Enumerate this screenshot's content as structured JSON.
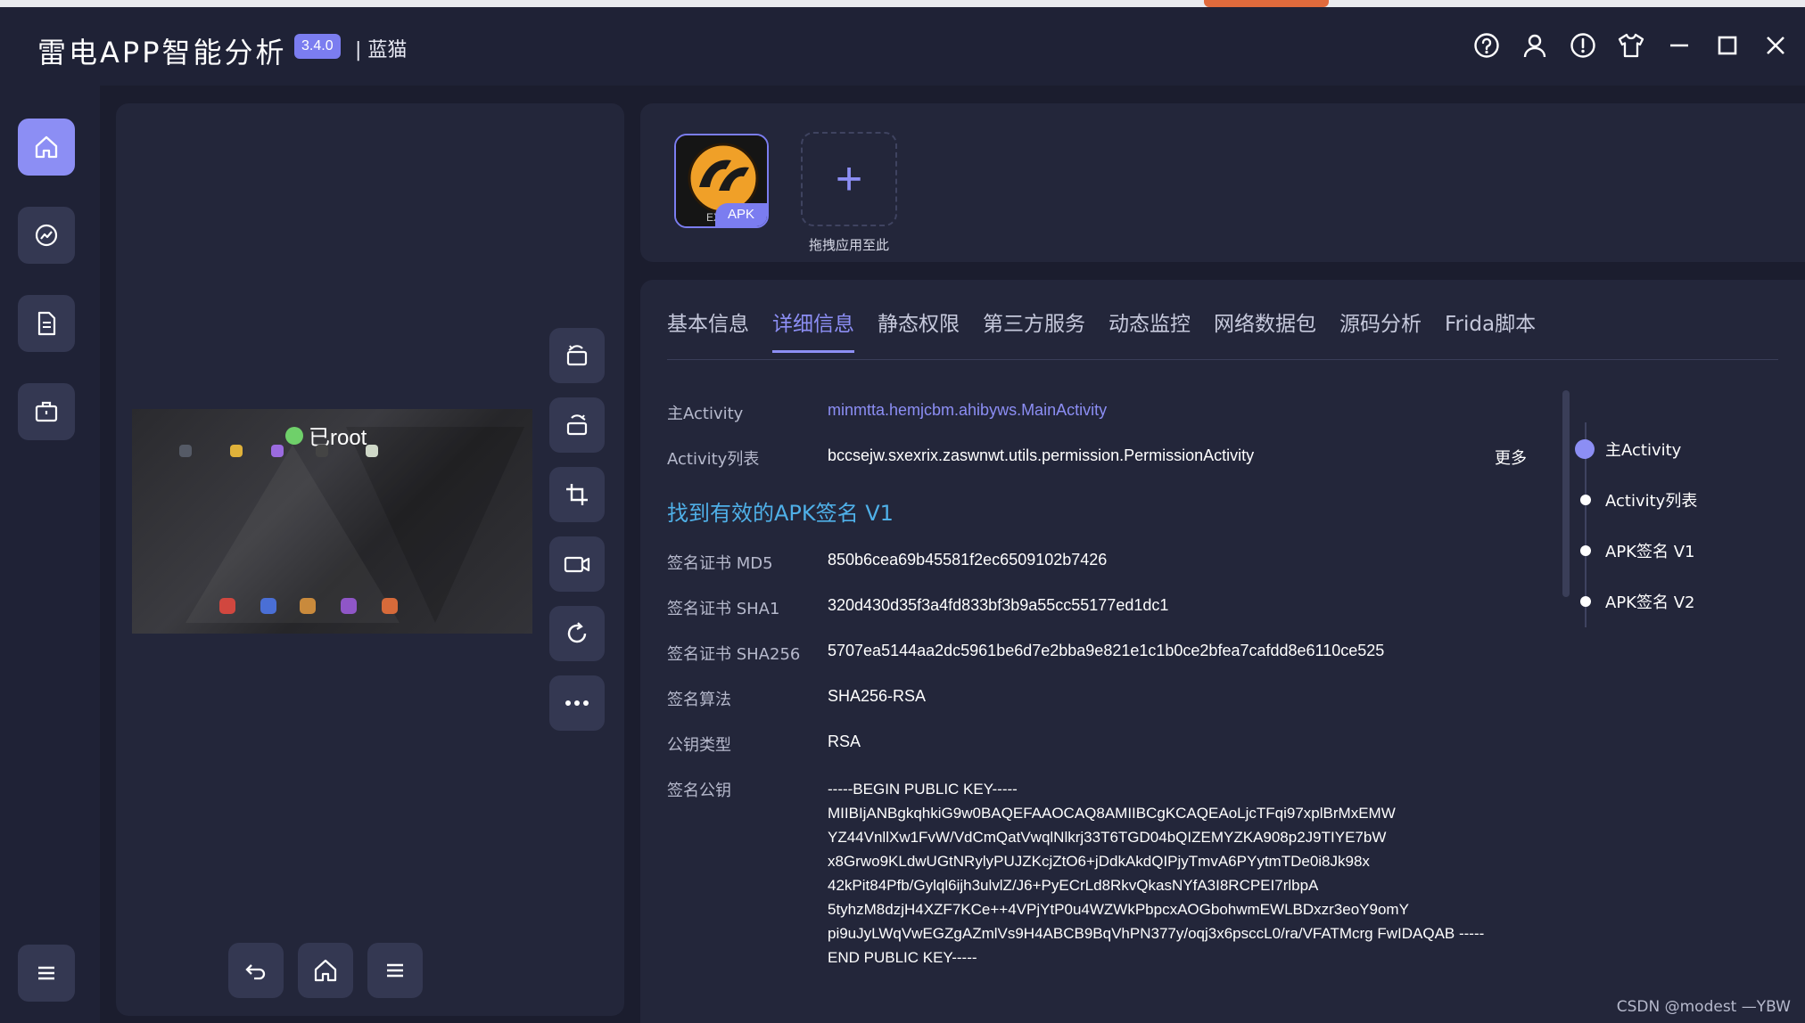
{
  "app": {
    "title": "雷电APP智能分析",
    "version": "3.4.0",
    "edition": "| 蓝猫"
  },
  "window_controls": [
    "help-icon",
    "user-icon",
    "alert-icon",
    "shirt-icon",
    "minimize-icon",
    "maximize-icon",
    "close-icon"
  ],
  "sidebar": {
    "items": [
      {
        "name": "home",
        "icon": "home-icon",
        "active": true
      },
      {
        "name": "analysis",
        "icon": "chart-icon",
        "active": false
      },
      {
        "name": "report",
        "icon": "document-icon",
        "active": false
      },
      {
        "name": "toolbox",
        "icon": "briefcase-icon",
        "active": false
      }
    ],
    "menu_icon": "menu-icon"
  },
  "device": {
    "root_label": "已root",
    "tools": [
      "rotate-left-icon",
      "rotate-right-icon",
      "crop-icon",
      "record-icon",
      "refresh-icon",
      "more-icon"
    ],
    "nav": [
      "back-icon",
      "home-icon",
      "menu-icon"
    ]
  },
  "apk": {
    "tag": "APK",
    "add_label": "拖拽应用至此",
    "add_symbol": "+"
  },
  "tabs": [
    "基本信息",
    "详细信息",
    "静态权限",
    "第三方服务",
    "动态监控",
    "网络数据包",
    "源码分析",
    "Frida脚本"
  ],
  "active_tab": "详细信息",
  "details": {
    "main_activity_label": "主Activity",
    "main_activity_value": "minmtta.hemjcbm.ahibyws.MainActivity",
    "activity_list_label": "Activity列表",
    "activity_list_value": "bccsejw.sxexrix.zaswnwt.utils.permission.PermissionActivity",
    "more": "更多",
    "signature_heading": "找到有效的APK签名 V1",
    "md5_label": "签名证书 MD5",
    "md5_value": "850b6cea69b45581f2ec6509102b7426",
    "sha1_label": "签名证书 SHA1",
    "sha1_value": "320d430d35f3a4fd833bf3b9a55cc55177ed1dc1",
    "sha256_label": "签名证书 SHA256",
    "sha256_value": "5707ea5144aa2dc5961be6d7e2bba9e821e1c1b0ce2bfea7cafdd8e6110ce525",
    "algo_label": "签名算法",
    "algo_value": "SHA256-RSA",
    "keytype_label": "公钥类型",
    "keytype_value": "RSA",
    "pubkey_label": "签名公钥",
    "pubkey_lines": [
      "-----BEGIN PUBLIC KEY-----",
      "MIIBIjANBgkqhkiG9w0BAQEFAAOCAQ8AMIIBCgKCAQEAoLjcTFqi97xplBrMxEMW",
      "YZ44VnllXw1FvW/VdCmQatVwqlNlkrj33T6TGD04bQIZEMYZKA908p2J9TIYE7bW",
      "x8Grwo9KLdwUGtNRylyPUJZKcjZtO6+jDdkAkdQIPjyTmvA6PYytmTDe0i8Jk98x",
      "42kPit84Pfb/Gylql6ijh3ulvlZ/J6+PyECrLd8RkvQkasNYfA3I8RCPEI7rlbpA",
      "5tyhzM8dzjH4XZF7KCe++4VPjYtP0u4WZWkPbpcxAOGbohwmEWLBDxzr3eoY9omY",
      "pi9uJyLWqVwEGZgAZmlVs9H4ABCB9BqVhPN377y/oqj3x6psccL0/ra/VFATMcrg FwIDAQAB -----",
      "END PUBLIC KEY-----"
    ]
  },
  "anchors": [
    "主Activity",
    "Activity列表",
    "APK签名 V1",
    "APK签名 V2"
  ],
  "watermark": "CSDN @modest —YBW"
}
